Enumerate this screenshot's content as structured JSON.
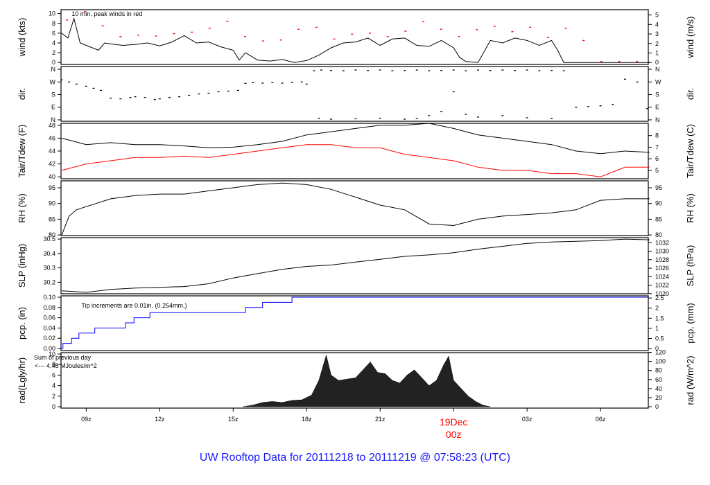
{
  "title": "UW Rooftop Data for 20111218  to  20111219 @ 07:58:23  (UTC)",
  "x_axis": {
    "start_hour": 7.97,
    "end_hour": 31.95,
    "ticks": [
      {
        "h": 9,
        "label": "09z"
      },
      {
        "h": 12,
        "label": "12z"
      },
      {
        "h": 15,
        "label": "15z"
      },
      {
        "h": 18,
        "label": "18z"
      },
      {
        "h": 21,
        "label": "21z"
      },
      {
        "h": 24,
        "label": "00z",
        "day": "19Dec"
      },
      {
        "h": 27,
        "label": "03z"
      },
      {
        "h": 30,
        "label": "06z"
      }
    ],
    "day_color": "#ff0000"
  },
  "chart_data": [
    {
      "id": "wind",
      "type": "line",
      "ylabel": "wind (kts)",
      "ylabel_right": "wind (m/s)",
      "ylim": [
        -0.4,
        10.8
      ],
      "ticks": [
        0,
        2,
        4,
        6,
        8,
        10
      ],
      "right_ticks": [
        0,
        1,
        2,
        3,
        4,
        5
      ],
      "right_factor": 0.5144,
      "annotation": "10 min. peak winds in red",
      "annotation_color": "#ff0000",
      "color": "#000000",
      "peak_color": "#ff0000",
      "x": [
        8,
        8.25,
        8.5,
        8.75,
        9,
        9.25,
        9.5,
        9.75,
        10,
        10.5,
        11,
        11.5,
        12,
        12.5,
        13,
        13.5,
        14,
        14.5,
        15,
        15.25,
        15.5,
        16,
        16.5,
        17,
        17.5,
        18,
        18.5,
        19,
        19.5,
        20,
        20.5,
        21,
        21.5,
        22,
        22.5,
        23,
        23.5,
        24,
        24.25,
        24.5,
        25,
        25.5,
        26,
        26.5,
        27,
        27.5,
        28,
        28.25,
        28.5,
        29,
        30,
        31,
        32
      ],
      "y": [
        6,
        5,
        9,
        4,
        3.5,
        3,
        2.5,
        4,
        3.8,
        3.5,
        3.7,
        4,
        3.4,
        4.2,
        5.5,
        4,
        4.2,
        3.2,
        2.5,
        0.5,
        2,
        0.5,
        0.3,
        0.6,
        0,
        0.4,
        1.5,
        3,
        4,
        4.2,
        5,
        3.5,
        4.8,
        5,
        3.5,
        3.3,
        4.5,
        3,
        1,
        0.2,
        0,
        4.5,
        4,
        5,
        4.5,
        3.5,
        4.5,
        2.5,
        0,
        0,
        0,
        0,
        0
      ],
      "peaks": [
        8.7,
        10.4,
        7.5,
        5.3,
        5.6,
        5.4,
        5.9,
        6.2,
        7,
        8.4,
        5.3,
        4.4,
        4.6,
        6.8,
        7.2,
        4.8,
        5.8,
        6,
        5.3,
        6.4,
        8.4,
        6.8,
        5.3,
        6.7,
        7.4,
        6.3,
        7.2,
        5.1,
        7,
        4.5,
        0.2,
        0.2,
        0.2
      ]
    },
    {
      "id": "dir",
      "type": "scatter",
      "ylabel": "dir.",
      "ylabel_right": "dir.",
      "ylim": [
        -10,
        380
      ],
      "tick_values": [
        0,
        90,
        180,
        270,
        360
      ],
      "tick_labels": [
        "N",
        "E",
        "S",
        "W",
        "N"
      ],
      "x": [
        8,
        8.3,
        8.6,
        9,
        9.3,
        9.6,
        10,
        10.4,
        10.8,
        11,
        11.4,
        11.8,
        12,
        12.4,
        12.8,
        13.2,
        13.6,
        14,
        14.4,
        14.8,
        15.2,
        15.5,
        15.8,
        16.2,
        16.6,
        17,
        17.4,
        17.8,
        18,
        18.3,
        18.6,
        19,
        19.5,
        20,
        20.5,
        21,
        21.5,
        22,
        22.5,
        23,
        23.5,
        24,
        24.5,
        25,
        25.5,
        26,
        26.5,
        27,
        27.5,
        28,
        28.5,
        29,
        29.5,
        30,
        30.5,
        31,
        31.5,
        31.9
      ],
      "y": [
        285,
        270,
        255,
        240,
        225,
        210,
        155,
        150,
        160,
        165,
        160,
        145,
        150,
        160,
        165,
        175,
        185,
        190,
        200,
        205,
        210,
        260,
        265,
        262,
        265,
        262,
        268,
        270,
        255,
        350,
        355,
        352,
        350,
        355,
        352,
        355,
        350,
        352,
        355,
        350,
        352,
        355,
        350,
        355,
        352,
        355,
        352,
        355,
        350,
        352,
        350,
        90,
        95,
        100,
        110,
        290,
        270,
        80
      ],
      "x2": [
        18.5,
        19,
        20,
        21,
        22,
        22.5,
        23,
        23.5,
        24,
        24.5,
        25,
        26,
        27,
        28
      ],
      "y2": [
        10,
        5,
        8,
        12,
        5,
        10,
        30,
        60,
        200,
        40,
        20,
        30,
        15,
        10
      ]
    },
    {
      "id": "temp",
      "type": "line",
      "ylabel": "Tair/Tdew (F)",
      "ylabel_right": "Tair/Tdew (C)",
      "ylim": [
        39.7,
        48.3
      ],
      "ticks": [
        40,
        42,
        44,
        46,
        48
      ],
      "right_ticks": [
        5,
        6,
        7,
        8
      ],
      "x": [
        8,
        9,
        10,
        11,
        12,
        13,
        14,
        15,
        16,
        17,
        18,
        19,
        20,
        21,
        22,
        23,
        24,
        25,
        26,
        27,
        28,
        29,
        30,
        31,
        32
      ],
      "series": [
        {
          "name": "Tair",
          "color": "#000000",
          "y": [
            46,
            45,
            45.3,
            45,
            45,
            44.8,
            44.5,
            44.6,
            45,
            45.5,
            46.5,
            47,
            47.5,
            48,
            48,
            48.3,
            47.5,
            46.5,
            46,
            45.5,
            45,
            44,
            43.6,
            44,
            43.8
          ]
        },
        {
          "name": "Tdew",
          "color": "#ff0000",
          "y": [
            41,
            42,
            42.5,
            43,
            43,
            43.2,
            43,
            43.5,
            44,
            44.5,
            45,
            45,
            44.5,
            44.5,
            43.5,
            43,
            42.5,
            41.5,
            41,
            41,
            40.5,
            40.5,
            40,
            41.5,
            41.5
          ]
        }
      ]
    },
    {
      "id": "rh",
      "type": "line",
      "ylabel": "RH (%)",
      "ylabel_right": "RH (%)",
      "ylim": [
        79.8,
        97.2
      ],
      "ticks": [
        80,
        85,
        90,
        95
      ],
      "right_ticks": [
        80,
        85,
        90,
        95
      ],
      "color": "#000000",
      "x": [
        8,
        8.3,
        8.6,
        9,
        10,
        11,
        12,
        13,
        14,
        15,
        16,
        17,
        18,
        19,
        20,
        21,
        22,
        23,
        24,
        25,
        26,
        27,
        28,
        29,
        30,
        31,
        32
      ],
      "y": [
        80,
        86,
        88,
        89,
        91.5,
        92.5,
        93,
        93,
        94,
        95,
        96,
        96.5,
        96,
        94.5,
        92,
        89.5,
        88,
        83.5,
        83,
        85,
        86,
        86.5,
        87,
        88,
        91,
        91.5,
        91.5
      ]
    },
    {
      "id": "slp",
      "type": "line",
      "ylabel": "SLP (inHg)",
      "ylabel_right": "SLP (hPa)",
      "ylim": [
        30.12,
        30.51
      ],
      "ticks": [
        30.2,
        30.3,
        30.4,
        30.5
      ],
      "right_ticks": [
        1020,
        1022,
        1024,
        1026,
        1028,
        1030,
        1032
      ],
      "color": "#000000",
      "x": [
        8,
        9,
        10,
        11,
        12,
        13,
        14,
        15,
        16,
        17,
        18,
        19,
        20,
        21,
        22,
        23,
        24,
        25,
        26,
        27,
        28,
        29,
        30,
        31,
        32
      ],
      "y": [
        30.14,
        30.13,
        30.15,
        30.16,
        30.165,
        30.17,
        30.19,
        30.23,
        30.26,
        30.29,
        30.31,
        30.32,
        30.34,
        30.36,
        30.38,
        30.39,
        30.405,
        30.43,
        30.45,
        30.47,
        30.48,
        30.485,
        30.49,
        30.5,
        30.495
      ]
    },
    {
      "id": "pcp",
      "type": "step",
      "ylabel": "pcp. (in)",
      "ylabel_right": "pcp. (mm)",
      "ylim": [
        -0.004,
        0.1027
      ],
      "ticks": [
        0,
        0.02,
        0.04,
        0.06,
        0.08,
        0.1
      ],
      "tick_labels": [
        "0.00",
        "0.02",
        "0.04",
        "0.06",
        "0.08",
        "0.10"
      ],
      "right_ticks": [
        0,
        0.5,
        1,
        1.5,
        2,
        2.5
      ],
      "annotation": "Tip increments are 0.01in. (0.254mm.)",
      "color": "#0000ff",
      "x": [
        7.97,
        8.05,
        8.4,
        8.7,
        9.35,
        10.6,
        10.95,
        11.6,
        15.5,
        16.2,
        17.4,
        31.95
      ],
      "y": [
        0,
        0.01,
        0.02,
        0.03,
        0.04,
        0.05,
        0.06,
        0.07,
        0.08,
        0.09,
        0.1,
        0.1
      ]
    },
    {
      "id": "rad",
      "type": "area",
      "ylabel": "rad(Lgly/hr)",
      "ylabel_right": "rad (W/m^2)",
      "ylim": [
        -0.26,
        10.26
      ],
      "ticks": [
        0,
        2,
        4,
        6,
        8,
        10
      ],
      "right_ticks": [
        0,
        20,
        40,
        60,
        80,
        100,
        120
      ],
      "right_factor": 11.63,
      "annotation": "Sum of previous day",
      "annotation2": "<--- 4.48 MJoules/m^2",
      "annotation_color": "#a020f0",
      "color": "#222222",
      "x": [
        15.4,
        15.8,
        16.2,
        16.6,
        17,
        17.4,
        17.8,
        18.2,
        18.5,
        18.8,
        19,
        19.3,
        19.6,
        20,
        20.3,
        20.6,
        20.9,
        21.2,
        21.5,
        21.8,
        22.1,
        22.4,
        22.7,
        23,
        23.3,
        23.6,
        23.8,
        24,
        24.3,
        24.6,
        24.9,
        25.2,
        25.5
      ],
      "y": [
        0,
        0.3,
        0.8,
        1,
        0.8,
        1.2,
        1.3,
        2.2,
        5,
        9.8,
        6,
        5,
        5.2,
        5.5,
        7,
        8.5,
        6.5,
        6.3,
        5,
        4.5,
        6,
        7,
        5.5,
        4,
        5,
        8,
        9.6,
        5,
        3.5,
        2,
        1,
        0.3,
        0
      ]
    }
  ]
}
